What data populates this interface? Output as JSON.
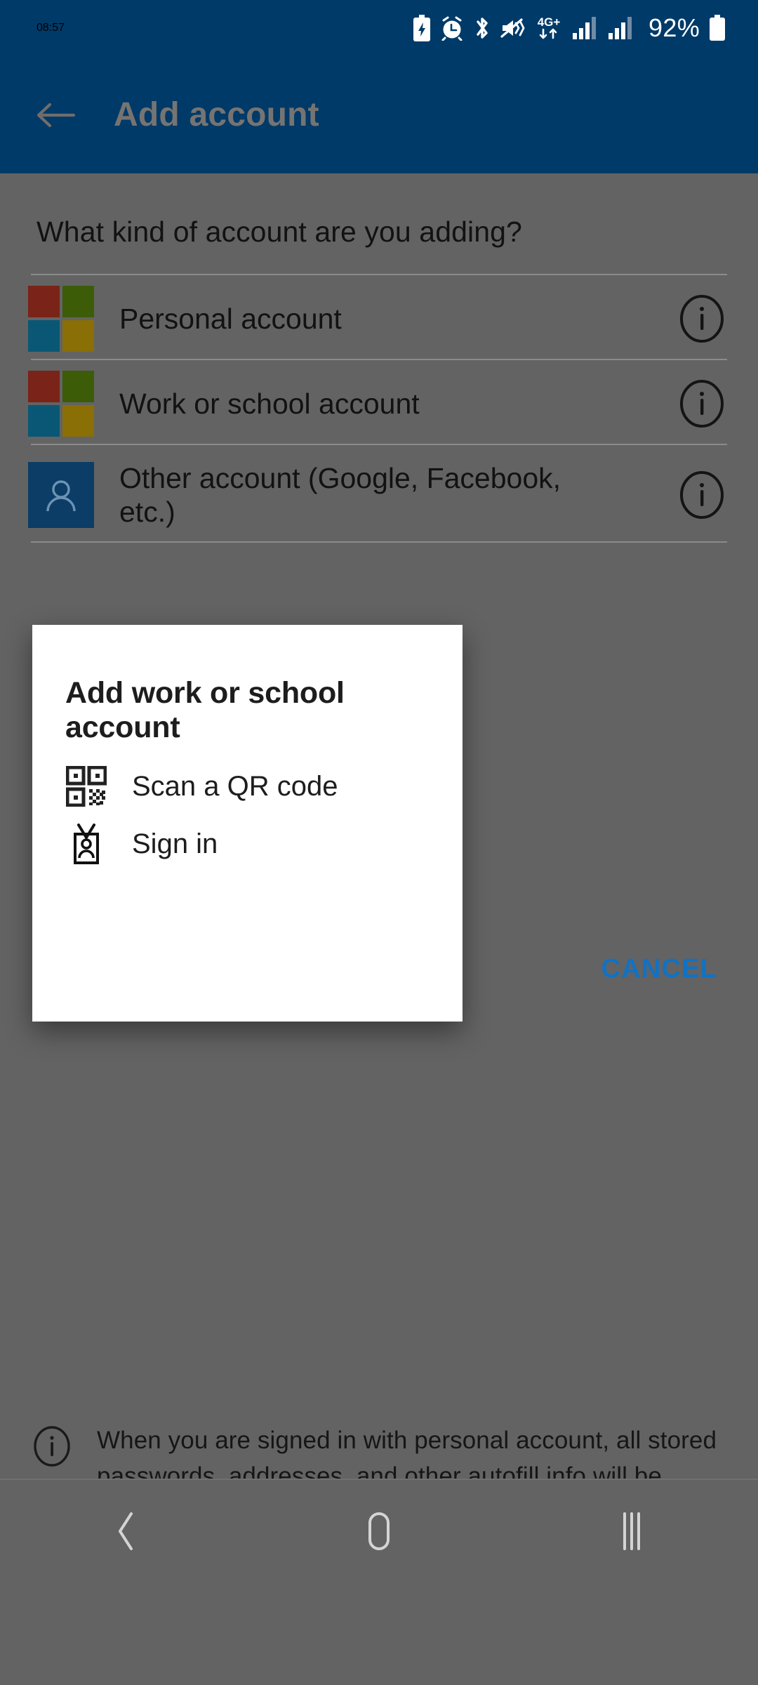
{
  "status_bar": {
    "clock": "08:57",
    "battery_percent": "92%",
    "icons": [
      "battery-saver-icon",
      "alarm-icon",
      "bluetooth-icon",
      "vibrate-icon",
      "4g-plus-data-icon",
      "signal-bars-sim1-icon",
      "signal-bars-sim2-icon",
      "battery-icon"
    ],
    "network_label": "4G+",
    "background_color": "#003a68",
    "foreground_color": "#ffffff"
  },
  "app_bar": {
    "title": "Add account",
    "back_icon": "back-arrow-icon",
    "background_color": "#003a68",
    "title_color": "#767472"
  },
  "content": {
    "question": "What kind of account are you adding?",
    "accounts": [
      {
        "label": "Personal account",
        "icon": "microsoft-logo-icon",
        "info_icon": "info-icon"
      },
      {
        "label": "Work or school account",
        "icon": "microsoft-logo-icon",
        "info_icon": "info-icon"
      },
      {
        "label": "Other account (Google, Facebook, etc.)",
        "icon": "person-tile-icon",
        "info_icon": "info-icon"
      }
    ],
    "microsoft_logo_colors": {
      "top_left": "#7a2318",
      "top_right": "#3d5c08",
      "bottom_left": "#0a5775",
      "bottom_right": "#8a6e06"
    },
    "person_tile_color": "#0b3d66",
    "footer_note": "When you are signed in with personal account, all stored passwords, addresses, and other autofill info will be available on this device.",
    "footer_icon": "info-icon"
  },
  "dialog": {
    "title": "Add work or school account",
    "options": [
      {
        "label": "Scan a QR code",
        "icon": "qr-code-icon"
      },
      {
        "label": "Sign in",
        "icon": "id-badge-icon"
      }
    ],
    "cancel_label": "CANCEL",
    "cancel_color": "#1072c4",
    "background_color": "#ffffff"
  },
  "nav_bar": {
    "buttons": [
      {
        "name": "back",
        "icon": "nav-back-chevron-icon"
      },
      {
        "name": "home",
        "icon": "nav-home-icon"
      },
      {
        "name": "recents",
        "icon": "nav-recents-icon"
      }
    ],
    "color": "#d4d4d4"
  }
}
